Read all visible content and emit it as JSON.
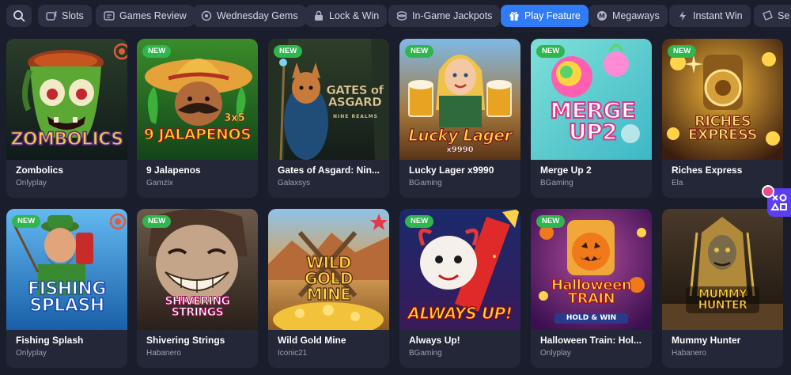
{
  "filters": [
    {
      "label": "Slots",
      "icon": "slot-machine-icon",
      "active": false
    },
    {
      "label": "Games Review",
      "icon": "review-icon",
      "active": false
    },
    {
      "label": "Wednesday Gems",
      "icon": "gem-icon",
      "active": false
    },
    {
      "label": "Lock & Win",
      "icon": "lock-icon",
      "active": false
    },
    {
      "label": "In-Game Jackpots",
      "icon": "jackpot-icon",
      "active": false
    },
    {
      "label": "Play Feature",
      "icon": "gift-icon",
      "active": true
    },
    {
      "label": "Megaways",
      "icon": "megaways-icon",
      "active": false
    },
    {
      "label": "Instant Win",
      "icon": "lightning-icon",
      "active": false
    },
    {
      "label": "Se",
      "icon": "ticket-icon",
      "active": false
    }
  ],
  "new_badge_label": "NEW",
  "games": [
    {
      "title": "Zombolics",
      "provider": "Onlyplay",
      "art_text": "ZOMBOLICS",
      "is_new": false
    },
    {
      "title": "9 Jalapenos",
      "provider": "Gamzix",
      "art_text": "9 JALAPENOS",
      "art_sub": "3x5",
      "is_new": true
    },
    {
      "title": "Gates of Asgard: Nin...",
      "provider": "Galaxsys",
      "art_text": "GATES of ASGARD",
      "art_sub": "NINE REALMS",
      "is_new": true
    },
    {
      "title": "Lucky Lager x9990",
      "provider": "BGaming",
      "art_text": "Lucky Lager",
      "art_sub": "x9990",
      "is_new": true
    },
    {
      "title": "Merge Up 2",
      "provider": "BGaming",
      "art_text": "MERGE UP2",
      "is_new": true
    },
    {
      "title": "Riches Express",
      "provider": "Ela",
      "art_text": "RICHES EXPRESS",
      "is_new": true
    },
    {
      "title": "Fishing Splash",
      "provider": "Onlyplay",
      "art_text": "FISHING SPLASH",
      "is_new": true
    },
    {
      "title": "Shivering Strings",
      "provider": "Habanero",
      "art_text": "SHIVERING STRINGS",
      "is_new": true
    },
    {
      "title": "Wild Gold Mine",
      "provider": "Iconic21",
      "art_text": "WILD GOLD MINE",
      "is_new": false
    },
    {
      "title": "Always Up!",
      "provider": "BGaming",
      "art_text": "ALWAYS UP!",
      "is_new": true
    },
    {
      "title": "Halloween Train: Hol...",
      "provider": "Onlyplay",
      "art_text": "Halloween TRAIN",
      "art_sub": "HOLD & WIN",
      "is_new": true
    },
    {
      "title": "Mummy Hunter",
      "provider": "Habanero",
      "art_text": "MUMMY HUNTER",
      "is_new": false
    }
  ],
  "colors": {
    "background": "#1a1d2c",
    "card": "#232738",
    "chip": "#2b2f42",
    "accent": "#2f7cf6",
    "new_badge": "#2fb64f"
  }
}
